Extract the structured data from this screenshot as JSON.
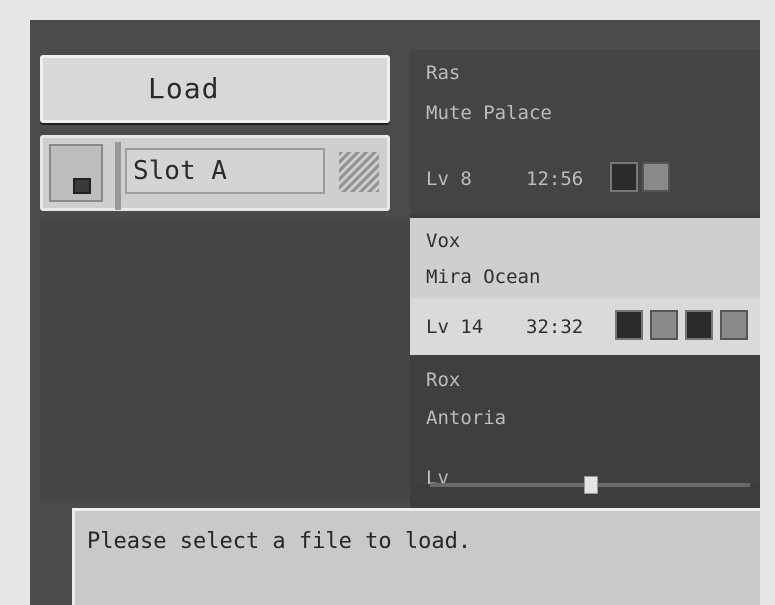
{
  "panel": {
    "title": "Load",
    "slot_label": "Slot A"
  },
  "saves": [
    {
      "line1": "Ras",
      "line2": "Mute Palace",
      "level": "Lv 8",
      "time": "12:56",
      "party_icons": [
        "character-portrait",
        "character-portrait"
      ]
    },
    {
      "line1": "Vox",
      "line2": "Mira Ocean",
      "level": "Lv 14",
      "time": "32:32",
      "party_icons": [
        "character-portrait",
        "character-portrait",
        "character-portrait",
        "character-portrait"
      ]
    },
    {
      "line1": "Rox",
      "line2": "Antoria",
      "level": "Lv"
    }
  ],
  "message": "Please select a file to load."
}
